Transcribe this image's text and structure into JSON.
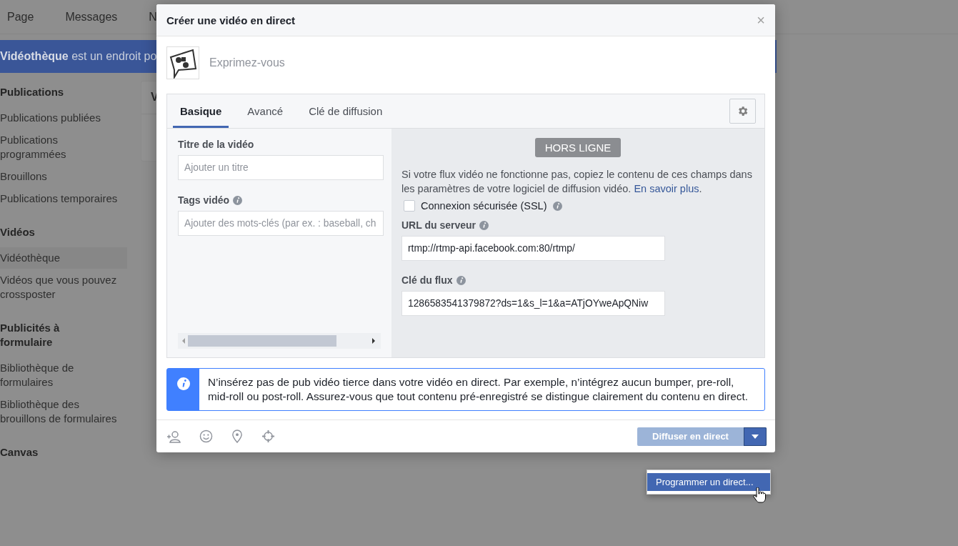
{
  "background_page": {
    "nav": [
      {
        "label": "Page"
      },
      {
        "label": "Messages"
      },
      {
        "label": "N"
      }
    ],
    "banner": "**Vidéothèque** est un endroit po",
    "sidebar": [
      {
        "title": "Publications",
        "items": [
          {
            "label": "Publications publiées",
            "selected": false
          },
          {
            "label": "Publications programmées",
            "selected": false
          },
          {
            "label": "Brouillons",
            "selected": false
          },
          {
            "label": "Publications temporaires",
            "selected": false
          }
        ]
      },
      {
        "title": "Vidéos",
        "items": [
          {
            "label": "Vidéothèque",
            "selected": true
          },
          {
            "label": "Vidéos que vous pouvez crossposter",
            "selected": false
          }
        ]
      },
      {
        "title": "Publicités à formulaire",
        "items": [
          {
            "label": "Bibliothèque de formulaires",
            "selected": false
          },
          {
            "label": "Bibliothèque des brouillons de formulaires",
            "selected": false
          }
        ]
      },
      {
        "title": "Canvas"
      }
    ],
    "card_heading": "V"
  },
  "dialog": {
    "title": "Créer une vidéo en direct",
    "close": "×",
    "composer": {
      "placeholder": "Exprimez-vous"
    },
    "tabs": [
      {
        "label": "Basique",
        "selected": true
      },
      {
        "label": "Avancé",
        "selected": false
      },
      {
        "label": "Clé de diffusion",
        "selected": false
      }
    ],
    "left": {
      "fields": [
        {
          "label": "Titre de la vidéo",
          "info": false,
          "placeholder": "Ajouter un titre"
        },
        {
          "label": "Tags vidéo",
          "info": true,
          "placeholder": "Ajouter des mots-clés (par ex. : baseball, ch"
        }
      ]
    },
    "right": {
      "status": "HORS LIGNE",
      "help": "Si votre flux vidéo ne fonctionne pas, copiez le contenu de ces champs dans les paramètres de votre logiciel de diffusion vidéo.",
      "help_link": "En savoir plus",
      "help_end": ".",
      "ssl": {
        "label": "Connexion sécurisée (SSL)",
        "checked": false
      },
      "fields": [
        {
          "label": "URL du serveur",
          "value": "rtmp://rtmp-api.facebook.com:80/rtmp/"
        },
        {
          "label": "Clé du flux",
          "value": "1286583541379872?ds=1&s_l=1&a=ATjOYweApQNiw"
        }
      ]
    },
    "notice": "N’insérez pas de pub vidéo tierce dans votre vidéo en direct. Par exemple, n’intégrez aucun bumper, pre-roll, mid-roll ou post-roll. Assurez-vous que tout contenu pré-enregistré se distingue clairement du contenu en direct.",
    "go_live": {
      "label": "Diffuser en direct",
      "disabled": true
    },
    "menu": [
      {
        "label": "Programmer un direct...",
        "selected": true
      }
    ]
  }
}
